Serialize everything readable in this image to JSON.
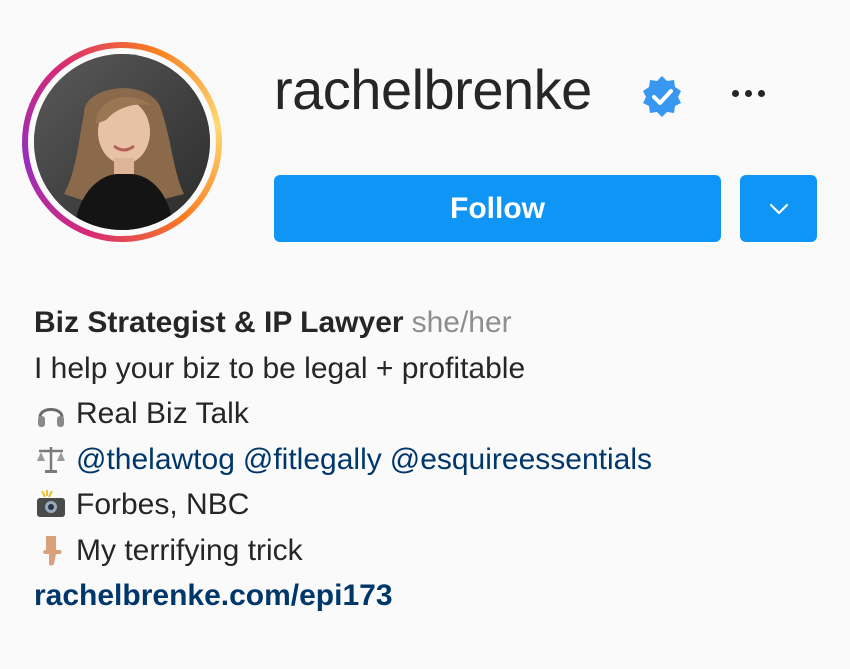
{
  "profile": {
    "username": "rachelbrenke",
    "verified": true,
    "avatar_alt": "profile photo"
  },
  "actions": {
    "follow_label": "Follow",
    "accent_color": "#0f95f6"
  },
  "bio": {
    "name": "Biz Strategist & IP Lawyer",
    "pronouns": "she/her",
    "tagline": "I help your biz to be legal + profitable",
    "line_podcast": {
      "icon": "headphones-icon",
      "text": "Real Biz Talk"
    },
    "line_accounts": {
      "icon": "balance-scale-icon",
      "mentions": [
        "@thelawtog",
        "@fitlegally",
        "@esquireessentials"
      ]
    },
    "line_press": {
      "icon": "camera-flash-icon",
      "text": "Forbes, NBC"
    },
    "line_trick": {
      "icon": "pointing-down-icon",
      "text": "My terrifying trick"
    },
    "website": "rachelbrenke.com/epi173"
  }
}
